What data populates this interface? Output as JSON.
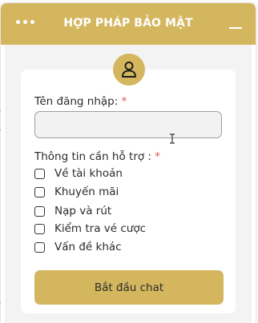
{
  "header": {
    "title": "HỢP PHÁP BẢO MẬT",
    "menu_icon": "more-dots-icon",
    "minimize_icon": "minimize-icon"
  },
  "form": {
    "avatar_icon": "user-icon",
    "username_label": "Tên đăng nhập:",
    "username_required": "*",
    "username_value": "",
    "support_label": "Thông tin cần hỗ trợ :",
    "support_required": "*",
    "options": [
      {
        "label": "Về tài khoản",
        "checked": false
      },
      {
        "label": "Khuyến mãi",
        "checked": false
      },
      {
        "label": "Nạp và rút",
        "checked": false
      },
      {
        "label": "Kiểm tra vé cược",
        "checked": false
      },
      {
        "label": "Vấn đề khác",
        "checked": false
      }
    ],
    "submit_label": "Bắt đầu chat"
  },
  "colors": {
    "accent": "#d4b65f",
    "required": "#e05252",
    "text": "#2b2b2b",
    "panel_bg": "#f3f3f3"
  }
}
